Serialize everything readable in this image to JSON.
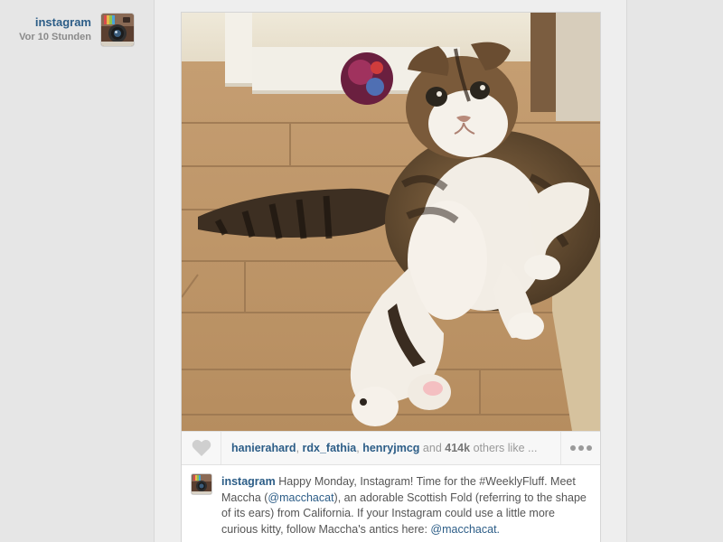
{
  "post": {
    "author": "instagram",
    "time": "Vor 10 Stunden",
    "likes": {
      "users": [
        "hanierahard",
        "rdx_fathia",
        "henryjmcg"
      ],
      "and_text": "and",
      "count": "414k",
      "others_text": "others like ..."
    },
    "caption": {
      "user": "instagram",
      "text_1": " Happy Monday, Instagram! Time for the #WeeklyFluff. Meet Maccha (",
      "mention_1": "@macchacat",
      "text_2": "), an adorable Scottish Fold (referring to the shape of its ears) from California. If your Instagram could use a little more curious kitty, follow Maccha's antics here: ",
      "mention_2": "@macchacat."
    }
  },
  "icons": {
    "avatar": "instagram-camera-icon",
    "like": "heart-icon",
    "more": "more-dots-icon"
  },
  "colors": {
    "link": "#2c5d87",
    "time": "#8a8a8a",
    "background": "#e6e6e6"
  }
}
